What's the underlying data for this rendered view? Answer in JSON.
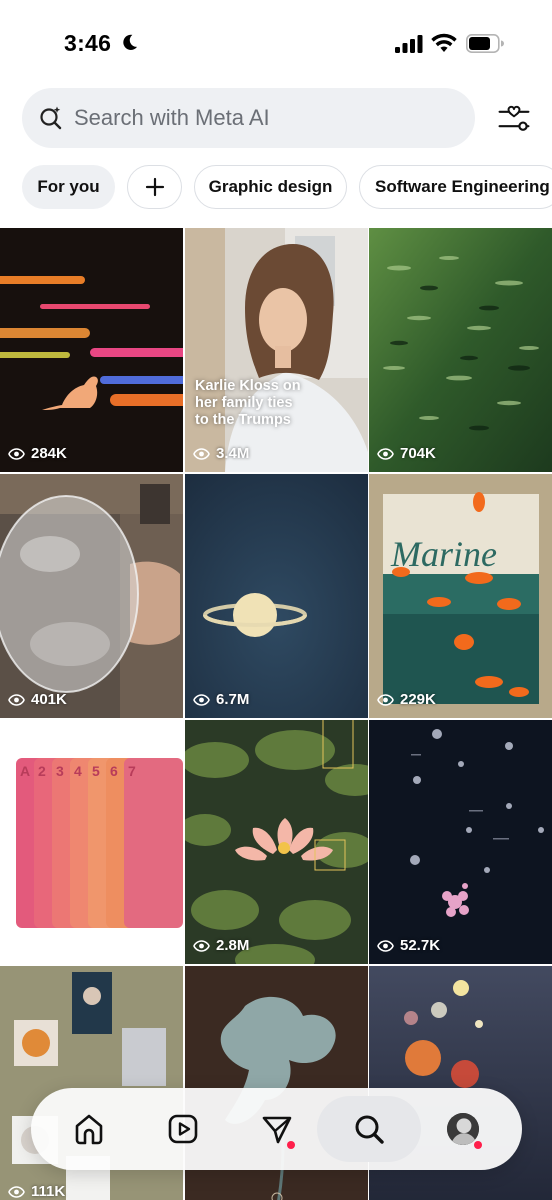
{
  "status_bar": {
    "time": "3:46"
  },
  "search": {
    "placeholder": "Search with Meta AI"
  },
  "chips": [
    {
      "label": "For you",
      "active": true
    },
    {
      "label": "+",
      "icon": "plus-icon"
    },
    {
      "label": "Graphic design"
    },
    {
      "label": "Software Engineering"
    }
  ],
  "grid": [
    {
      "views": "284K",
      "art": "neon-light-streaks-cat"
    },
    {
      "views": "3.4M",
      "caption": "Karlie Kloss on her family ties to the Trumps",
      "art": "portrait-woman"
    },
    {
      "views": "704K",
      "art": "green-fish-school"
    },
    {
      "views": "401K",
      "art": "clear-sphere"
    },
    {
      "views": "6.7M",
      "art": "saturn"
    },
    {
      "views": "229K",
      "art": "marine-poster"
    },
    {
      "art": "playing-cards-gradient"
    },
    {
      "views": "2.8M",
      "art": "water-lily"
    },
    {
      "views": "52.7K",
      "art": "floating-flowers-dark"
    },
    {
      "views": "111K",
      "art": "collage-board"
    },
    {
      "art": "blue-flower-poster"
    },
    {
      "art": "planets-bokeh"
    }
  ],
  "bottom_nav": [
    {
      "icon": "home-icon"
    },
    {
      "icon": "reels-icon"
    },
    {
      "icon": "send-icon",
      "notification": true
    },
    {
      "icon": "search-icon",
      "active": true
    },
    {
      "icon": "profile-avatar",
      "notification": true
    }
  ],
  "colors": {
    "notification_dot": "#ff1f4b",
    "chip_active_bg": "#eef0f3",
    "search_bg": "#eef0f3"
  }
}
